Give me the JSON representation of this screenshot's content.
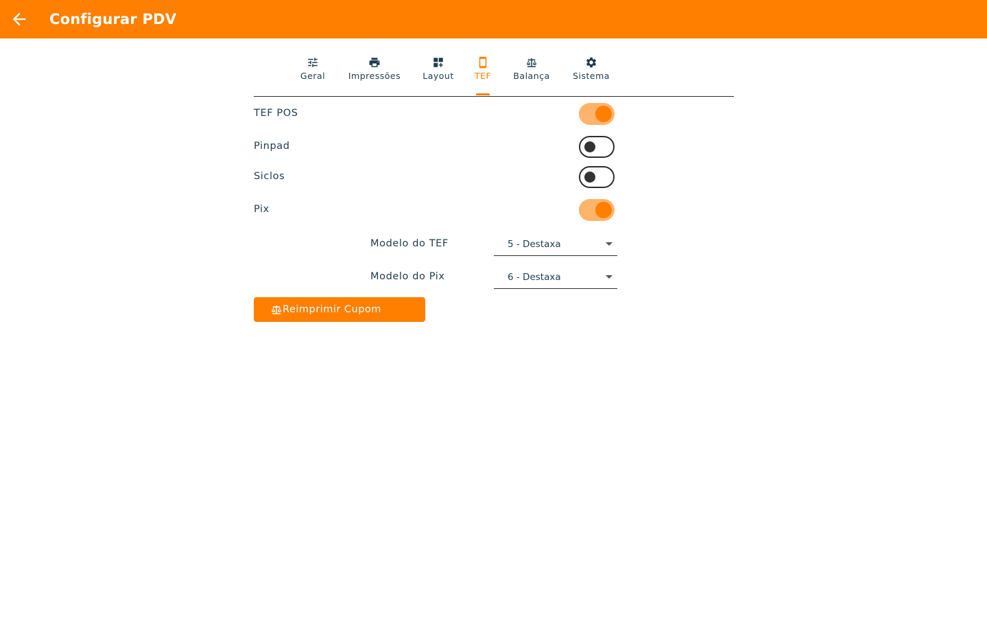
{
  "appbar": {
    "title": "Configurar PDV",
    "back_icon": "arrow-back-icon",
    "color": "#ff7f00"
  },
  "tabs": [
    {
      "label": "Geral",
      "icon": "tune-icon",
      "active": false
    },
    {
      "label": "Impressões",
      "icon": "print-icon",
      "active": false
    },
    {
      "label": "Layout",
      "icon": "dashboard-customize-icon",
      "active": false
    },
    {
      "label": "TEF",
      "icon": "smartphone-icon",
      "active": true
    },
    {
      "label": "Balança",
      "icon": "scale-icon",
      "active": false
    },
    {
      "label": "Sistema",
      "icon": "settings-cog-icon",
      "active": false
    }
  ],
  "toggles": [
    {
      "label": "TEF POS",
      "on": true
    },
    {
      "label": "Pinpad",
      "on": false
    },
    {
      "label": "Siclos",
      "on": false
    },
    {
      "label": "Pix",
      "on": true
    }
  ],
  "fields": {
    "tef_model": {
      "label": "Modelo do TEF",
      "value": "5 - Destaxa"
    },
    "pix_model": {
      "label": "Modelo do Pix",
      "value": "6 - Destaxa"
    }
  },
  "reprint_button": {
    "label": "Reimprimir Cupom",
    "icon": "scale-icon"
  },
  "colors": {
    "accent": "#ff7f00",
    "switch_track_on": "#ffb36b",
    "text": "#1f3b4d"
  }
}
